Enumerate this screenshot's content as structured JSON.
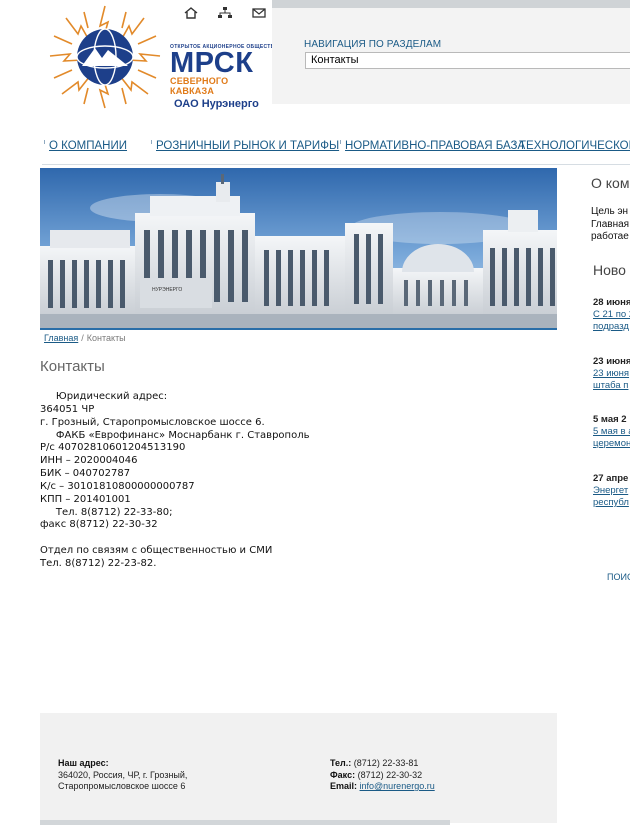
{
  "header": {
    "logo": {
      "small_caption": "Открытое акционерное общество",
      "brand": "МРСК",
      "region": "Северного Кавказа",
      "company": "ОАО Нурэнерго"
    },
    "util_icons": [
      "home-icon",
      "sitemap-icon",
      "mail-icon"
    ],
    "nav": {
      "label": "НАВИГАЦИЯ ПО РАЗДЕЛАМ",
      "selected": "Контакты"
    }
  },
  "main_menu": [
    {
      "label": "О КОМПАНИИ"
    },
    {
      "label": "РОЗНИЧНЫЙ РЫНОК И ТАРИФЫ"
    },
    {
      "label": "НОРМАТИВНО-ПРАВОВАЯ БАЗА"
    },
    {
      "label": "ТЕХНОЛОГИЧЕСКОЕ П"
    }
  ],
  "banner": {
    "sign": "НУРЭНЕРГО"
  },
  "breadcrumb": {
    "home": "Главная",
    "separator": "/",
    "current": "Контакты"
  },
  "page": {
    "title": "Контакты",
    "lines": [
      "     Юридический адрес:",
      "364051 ЧР",
      "г. Грозный, Старопромысловское шоссе 6.",
      "     ФАКБ «Еврофинанс» Моснарбанк г. Ставрополь",
      "Р/с 40702810601204513190",
      "ИНН – 2020004046",
      "БИК – 040702787",
      "К/с – 30101810800000000787",
      "КПП – 201401001",
      "     Тел. 8(8712) 22-33-80;",
      "факс 8(8712) 22-30-32",
      "",
      "Отдел по связям с общественностью и СМИ",
      "Тел. 8(8712) 22-23-82."
    ]
  },
  "right_column": {
    "title": "О ком",
    "body": [
      "Цель эн",
      "Главная",
      "работае"
    ],
    "news_title": "Ново",
    "news": [
      {
        "date": "28 июня",
        "links": [
          "С 21 по 2",
          "подразд"
        ]
      },
      {
        "date": "23 июня",
        "links": [
          "23 июня",
          "штаба п"
        ]
      },
      {
        "date": "5 мая 2",
        "links": [
          "5 мая в а",
          "церемон"
        ]
      },
      {
        "date": "27 апре",
        "links": [
          "Энергет",
          "республ"
        ]
      }
    ],
    "search": "ПОИС"
  },
  "footer": {
    "address_label": "Наш адрес:",
    "address_lines": [
      "364020, Россия, ЧР, г. Грозный,",
      "Старопромысловское шоссе 6"
    ],
    "tel_label": "Тел.:",
    "tel_value": "(8712) 22-33-81",
    "fax_label": "Факс:",
    "fax_value": "(8712) 22-30-32",
    "email_label": "Email:",
    "email_value": "info@nurenergo.ru"
  },
  "colors": {
    "link": "#1a5a86",
    "brand_blue": "#1d3f8a",
    "brand_orange": "#e07a18",
    "footer_bg": "#f1f1f1"
  }
}
